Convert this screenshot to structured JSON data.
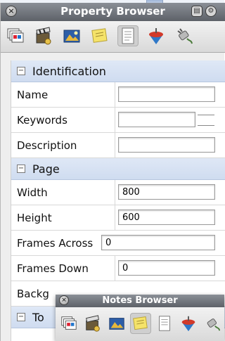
{
  "window": {
    "title": "Property Browser"
  },
  "toolbar": {
    "tools": [
      {
        "icon": "slides-stack-icon"
      },
      {
        "icon": "clapperboard-icon"
      },
      {
        "icon": "media-slide-icon"
      },
      {
        "icon": "sticky-notes-icon"
      },
      {
        "icon": "document-page-icon",
        "selected": true
      },
      {
        "icon": "spinning-top-icon"
      },
      {
        "icon": "plug-cable-icon"
      }
    ]
  },
  "sections": {
    "identification": {
      "label": "Identification",
      "fields": {
        "name": {
          "label": "Name",
          "value": ""
        },
        "keywords": {
          "label": "Keywords",
          "value": ""
        },
        "description": {
          "label": "Description",
          "value": ""
        }
      }
    },
    "page": {
      "label": "Page",
      "fields": {
        "width": {
          "label": "Width",
          "value": "800"
        },
        "height": {
          "label": "Height",
          "value": "600"
        },
        "frames_across": {
          "label": "Frames Across",
          "value": "0"
        },
        "frames_down": {
          "label": "Frames Down",
          "value": "0"
        },
        "background": {
          "label": "Backg"
        }
      }
    },
    "next": {
      "label": "To"
    }
  },
  "notes_browser": {
    "title": "Notes Browser"
  },
  "colors": {
    "section_header": "#d6e1f3",
    "titlebar": "#6f747b"
  }
}
